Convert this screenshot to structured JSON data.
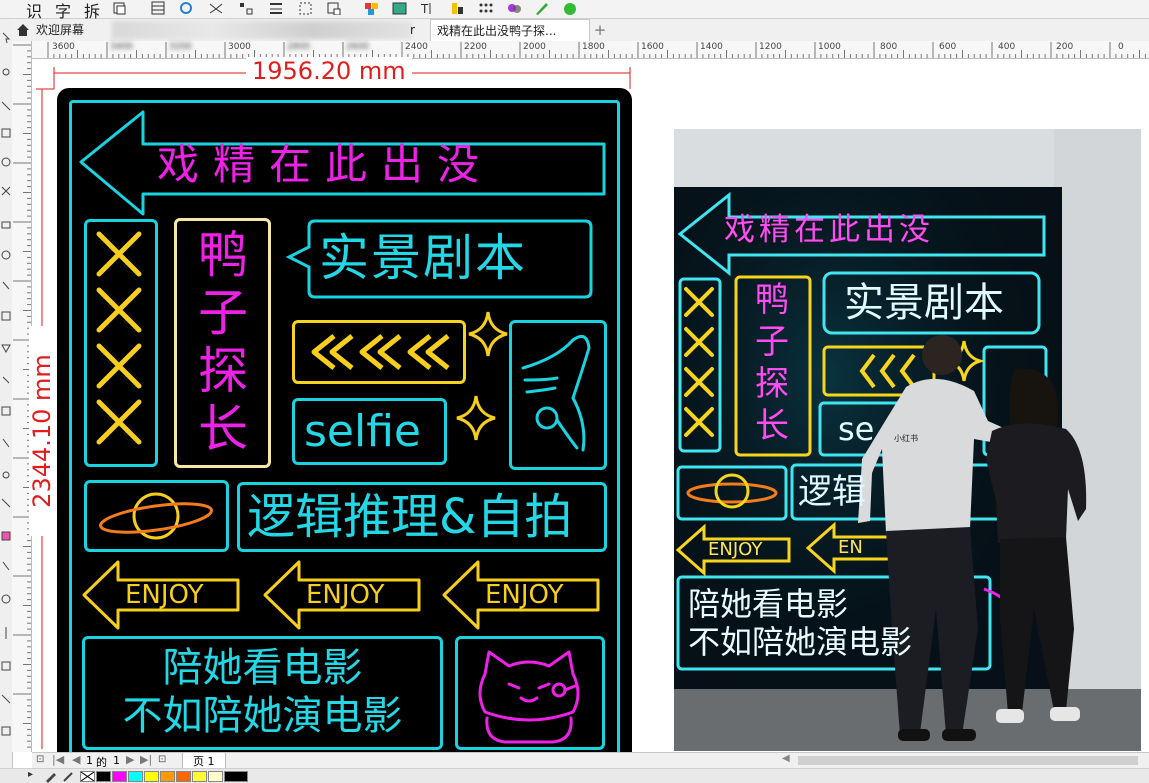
{
  "toolbar": {
    "items": [
      "识",
      "字",
      "拆"
    ]
  },
  "tabs": {
    "home_icon": "home-icon",
    "welcome": "欢迎屏幕",
    "hidden_tab_tail": "r",
    "doc": "戏精在此出没鸭子探...",
    "add": "+"
  },
  "rulers": {
    "h_ticks": [
      "3600",
      "3400",
      "3200",
      "3000",
      "2800",
      "2600",
      "2400",
      "2200",
      "2000",
      "1800",
      "1600",
      "1400",
      "1200",
      "1000",
      "800",
      "600",
      "400",
      "200",
      "0"
    ],
    "width_dim": "1956.20 mm",
    "height_dim": "2344.10 mm"
  },
  "sign": {
    "header": "戏精在此出没",
    "vertical_title": [
      "鸭",
      "子",
      "探",
      "长"
    ],
    "bubble": "实景剧本",
    "chevrons": "《《《",
    "selfie": "selfie",
    "logic": "逻辑推理&自拍",
    "enjoy": "ENJOY",
    "movie_line1": "陪她看电影",
    "movie_line2": "不如陪她演电影"
  },
  "photo": {
    "header": "戏精在此出没",
    "vertical_title": [
      "鸭",
      "子",
      "探",
      "长"
    ],
    "bubble": "实景剧本",
    "selfie_partial": "se",
    "logic_partial": "逻辑",
    "enjoy": "ENJOY",
    "enjoy_partial": "EN",
    "movie_line1": "陪她看电影",
    "movie_line2": "不如陪她演电影",
    "shirt_text": "小红书"
  },
  "pagenav": {
    "current": "1",
    "of": "的",
    "total": "1",
    "page_tab": "页 1"
  },
  "palette": {
    "colors": [
      "#000000",
      "#ff00ff",
      "#00ffff",
      "#ffff00",
      "#ff9900",
      "#ff6600",
      "#ffff33",
      "#ffffcc",
      "#000000"
    ]
  }
}
